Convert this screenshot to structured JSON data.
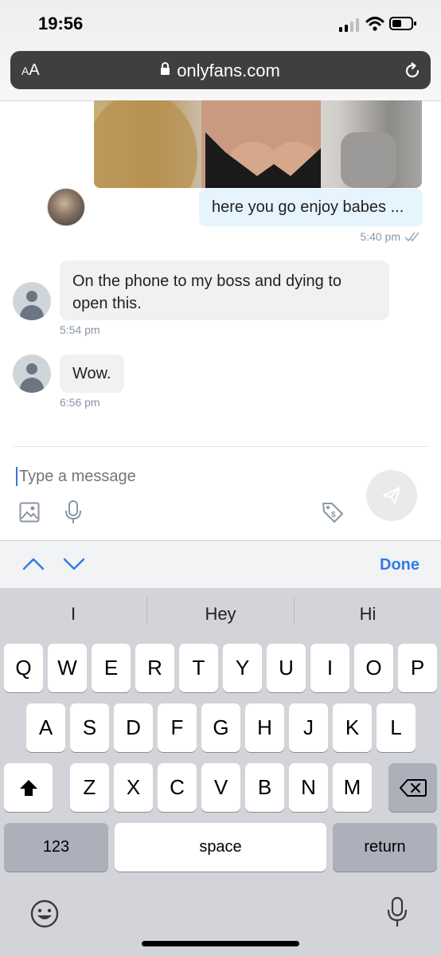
{
  "status_bar": {
    "time": "19:56"
  },
  "browser": {
    "aa_label_small": "A",
    "aa_label_big": "A",
    "url": "onlyfans.com"
  },
  "messages": [
    {
      "text": "here you go enjoy babes ...",
      "time": "5:40 pm",
      "direction": "outgoing"
    },
    {
      "text": "On the phone to my boss and dying to open this.",
      "time": "5:54 pm",
      "direction": "incoming"
    },
    {
      "text": "Wow.",
      "time": "6:56 pm",
      "direction": "incoming"
    }
  ],
  "composer": {
    "placeholder": "Type a message"
  },
  "accessory": {
    "done_label": "Done"
  },
  "keyboard": {
    "suggestions": [
      "I",
      "Hey",
      "Hi"
    ],
    "row1": [
      "Q",
      "W",
      "E",
      "R",
      "T",
      "Y",
      "U",
      "I",
      "O",
      "P"
    ],
    "row2": [
      "A",
      "S",
      "D",
      "F",
      "G",
      "H",
      "J",
      "K",
      "L"
    ],
    "row3": [
      "Z",
      "X",
      "C",
      "V",
      "B",
      "N",
      "M"
    ],
    "numbers_label": "123",
    "space_label": "space",
    "return_label": "return"
  },
  "colors": {
    "accent": "#2f7be6",
    "outgoing_bubble": "#e5f4fd",
    "incoming_bubble": "#f1f1f3",
    "meta": "#8a96a3"
  }
}
